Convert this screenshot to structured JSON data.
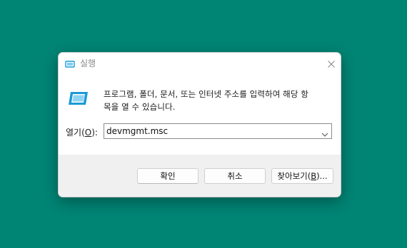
{
  "window": {
    "title": "실행",
    "icon": "run-app-icon",
    "close_icon": "close-icon"
  },
  "body": {
    "icon": "run-app-icon",
    "description_line1": "프로그램, 폴더, 문서, 또는 인터넷 주소를 입력하여 해당 항",
    "description_line2": "목을 열 수 있습니다.",
    "open_label_prefix": "열기(",
    "open_label_accel": "O",
    "open_label_suffix": "):",
    "open_value": "devmgmt.msc",
    "dropdown_icon": "chevron-down-icon"
  },
  "buttons": {
    "ok_label": "확인",
    "cancel_label": "취소",
    "browse_prefix": "찾아보기(",
    "browse_accel": "B",
    "browse_suffix": ")..."
  },
  "colors": {
    "desktop_bg": "#008575",
    "icon_blue": "#1a9ad6"
  }
}
